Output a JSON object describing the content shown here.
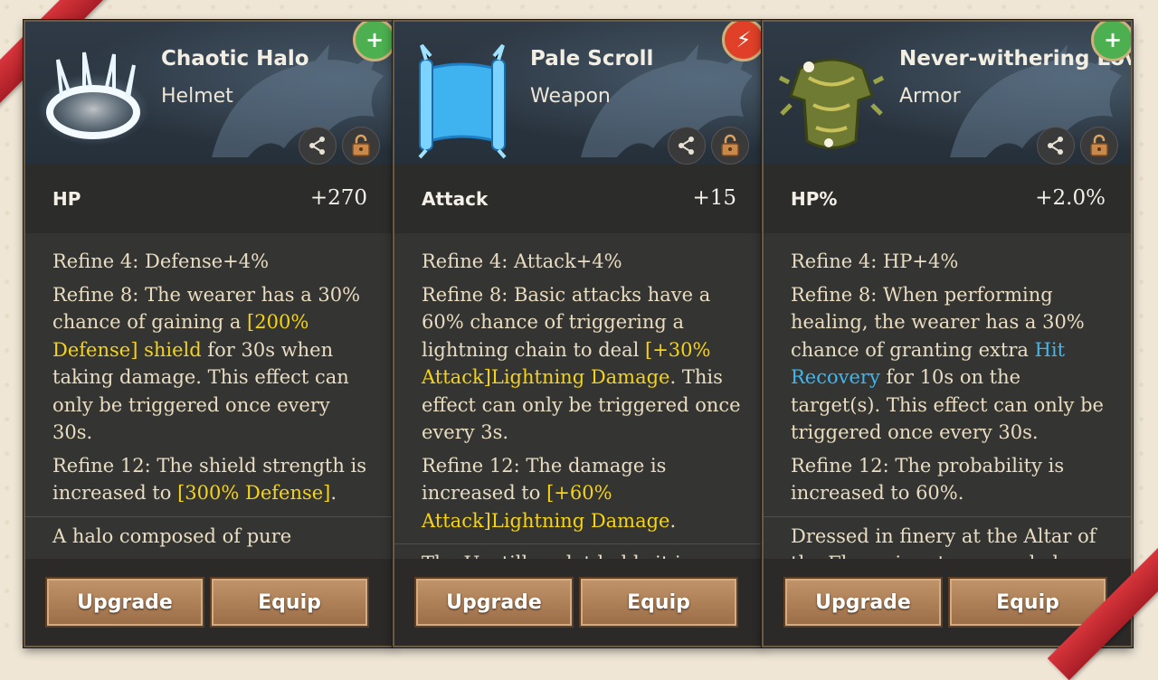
{
  "cards": [
    {
      "name": "Chaotic Halo",
      "type": "Helmet",
      "badge": "+",
      "stat_name": "HP",
      "stat_value": "+270",
      "refine4": "Refine 4: Defense+4%",
      "refine8_a": "Refine 8: The wearer has a 30% chance of gaining a ",
      "refine8_hl": "[200% Defense] shield",
      "refine8_b": " for 30s when taking damage. This effect can only be triggered once every 30s.",
      "refine12_a": "Refine 12: The shield strength is increased to ",
      "refine12_hl": "[300% Defense]",
      "refine12_b": ".",
      "lore": "A halo composed of pure",
      "upgrade": "Upgrade",
      "equip": "Equip"
    },
    {
      "name": "Pale Scroll",
      "type": "Weapon",
      "badge": "⚡",
      "stat_name": "Attack",
      "stat_value": "+15",
      "refine4": "Refine 4: Attack+4%",
      "refine8_a": "Refine 8: Basic attacks have a 60% chance of triggering a lightning chain to deal ",
      "refine8_hl": "[+30% Attack]Lightning Damage",
      "refine8_b": ". This effect can only be triggered once every 3s.",
      "refine12_a": "Refine 12: The damage is increased to ",
      "refine12_hl": "[+60% Attack]Lightning Damage",
      "refine12_b": ".",
      "lore": "The Unstill zealot holds it in",
      "upgrade": "Upgrade",
      "equip": "Equip"
    },
    {
      "name": "Never-withering Love",
      "type": "Armor",
      "badge": "+",
      "stat_name": "HP%",
      "stat_value": "+2.0%",
      "refine4": "Refine 4: HP+4%",
      "refine8_a": "Refine 8: When performing healing, the wearer has a 30% chance of granting extra ",
      "refine8_hl": "Hit Recovery",
      "refine8_b": " for 10s on the target(s). This effect can only be triggered once every 30s.",
      "refine12_a": "Refine 12: The probability is increased to 60%.",
      "refine12_hl": "",
      "refine12_b": "",
      "lore": "Dressed in finery at the Altar of the Flowering, true wood elves",
      "upgrade": "Upgrade",
      "equip": "Equip"
    }
  ],
  "colors": {
    "highlight_yellow": "#f5d316",
    "highlight_blue": "#3db8f0",
    "badge_green": "#4caf50",
    "badge_red": "#e04028"
  },
  "icons": [
    "share-icon",
    "unlock-icon",
    "plus-badge-icon",
    "lightning-badge-icon"
  ]
}
